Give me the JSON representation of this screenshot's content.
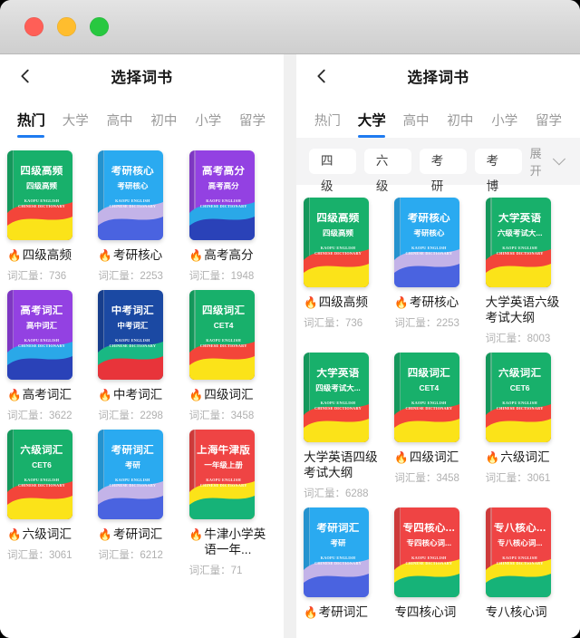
{
  "window": {
    "traffic_lights": [
      "close",
      "minimize",
      "zoom"
    ],
    "colors": {
      "close": "#ff5f57",
      "minimize": "#ffbd2e",
      "zoom": "#28c840",
      "accent": "#1f7bf0"
    }
  },
  "cover_en_line1": "KAOPU ENGLISH",
  "cover_en_line2": "CHINESE DICTIONARY",
  "fire": "🔥",
  "left": {
    "nav": {
      "back_icon": "back-arrow-icon",
      "title": "选择词书"
    },
    "tabs": [
      {
        "label": "热门",
        "active": true
      },
      {
        "label": "大学",
        "active": false
      },
      {
        "label": "高中",
        "active": false
      },
      {
        "label": "初中",
        "active": false
      },
      {
        "label": "小学",
        "active": false
      },
      {
        "label": "留学",
        "active": false
      }
    ],
    "books": [
      {
        "title": "四级高频",
        "cover_title": "四级高频",
        "cover_sub": "四级高频",
        "count_label": "词汇量：736",
        "hot": true,
        "theme": "green-red-yellow"
      },
      {
        "title": "考研核心",
        "cover_title": "考研核心",
        "cover_sub": "考研核心",
        "count_label": "词汇量：2253",
        "hot": true,
        "theme": "blue-lilac-indigo"
      },
      {
        "title": "高考高分",
        "cover_title": "高考高分",
        "cover_sub": "高考高分",
        "count_label": "词汇量：1948",
        "hot": true,
        "theme": "purple-cyan-indigo"
      },
      {
        "title": "高考词汇",
        "cover_title": "高考词汇",
        "cover_sub": "高中词汇",
        "count_label": "词汇量：3622",
        "hot": true,
        "theme": "purple-cyan-indigo"
      },
      {
        "title": "中考词汇",
        "cover_title": "中考词汇",
        "cover_sub": "中考词汇",
        "count_label": "词汇量：2298",
        "hot": true,
        "theme": "navy-green-red"
      },
      {
        "title": "四级词汇",
        "cover_title": "四级词汇",
        "cover_sub": "CET4",
        "count_label": "词汇量：3458",
        "hot": true,
        "theme": "green-red-yellow"
      },
      {
        "title": "六级词汇",
        "cover_title": "六级词汇",
        "cover_sub": "CET6",
        "count_label": "词汇量：3061",
        "hot": true,
        "theme": "green-red-yellow"
      },
      {
        "title": "考研词汇",
        "cover_title": "考研词汇",
        "cover_sub": "考研",
        "count_label": "词汇量：6212",
        "hot": true,
        "theme": "blue-lilac-indigo"
      },
      {
        "title": "牛津小学英语一年...",
        "cover_title": "上海牛津版",
        "cover_sub": "一年级上册",
        "count_label": "词汇量：71",
        "hot": true,
        "theme": "red-yellow-green"
      }
    ]
  },
  "right": {
    "nav": {
      "back_icon": "back-arrow-icon",
      "title": "选择词书"
    },
    "tabs": [
      {
        "label": "热门",
        "active": false
      },
      {
        "label": "大学",
        "active": true
      },
      {
        "label": "高中",
        "active": false
      },
      {
        "label": "初中",
        "active": false
      },
      {
        "label": "小学",
        "active": false
      },
      {
        "label": "留学",
        "active": false
      }
    ],
    "filters": {
      "chips": [
        "四级",
        "六级",
        "考研",
        "考博"
      ],
      "expand_label": "展开",
      "expand_icon": "chevron-down-icon"
    },
    "books": [
      {
        "title": "四级高频",
        "cover_title": "四级高频",
        "cover_sub": "四级高频",
        "count_label": "词汇量：736",
        "hot": true,
        "theme": "green-red-yellow"
      },
      {
        "title": "考研核心",
        "cover_title": "考研核心",
        "cover_sub": "考研核心",
        "count_label": "词汇量：2253",
        "hot": true,
        "theme": "blue-lilac-indigo"
      },
      {
        "title": "大学英语六级考试大纲",
        "cover_title": "大学英语",
        "cover_sub": "六级考试大...",
        "count_label": "词汇量：8003",
        "hot": false,
        "theme": "green-red-yellow"
      },
      {
        "title": "大学英语四级考试大纲",
        "cover_title": "大学英语",
        "cover_sub": "四级考试大...",
        "count_label": "词汇量：6288",
        "hot": false,
        "theme": "green-red-yellow"
      },
      {
        "title": "四级词汇",
        "cover_title": "四级词汇",
        "cover_sub": "CET4",
        "count_label": "词汇量：3458",
        "hot": true,
        "theme": "green-red-yellow"
      },
      {
        "title": "六级词汇",
        "cover_title": "六级词汇",
        "cover_sub": "CET6",
        "count_label": "词汇量：3061",
        "hot": true,
        "theme": "green-red-yellow"
      },
      {
        "title": "考研词汇",
        "cover_title": "考研词汇",
        "cover_sub": "考研",
        "count_label": "",
        "hot": true,
        "theme": "blue-lilac-indigo"
      },
      {
        "title": "专四核心词",
        "cover_title": "专四核心...",
        "cover_sub": "专四核心词...",
        "count_label": "",
        "hot": false,
        "theme": "red-yellow-green"
      },
      {
        "title": "专八核心词",
        "cover_title": "专八核心...",
        "cover_sub": "专八核心词...",
        "count_label": "",
        "hot": false,
        "theme": "red-yellow-green"
      }
    ]
  }
}
